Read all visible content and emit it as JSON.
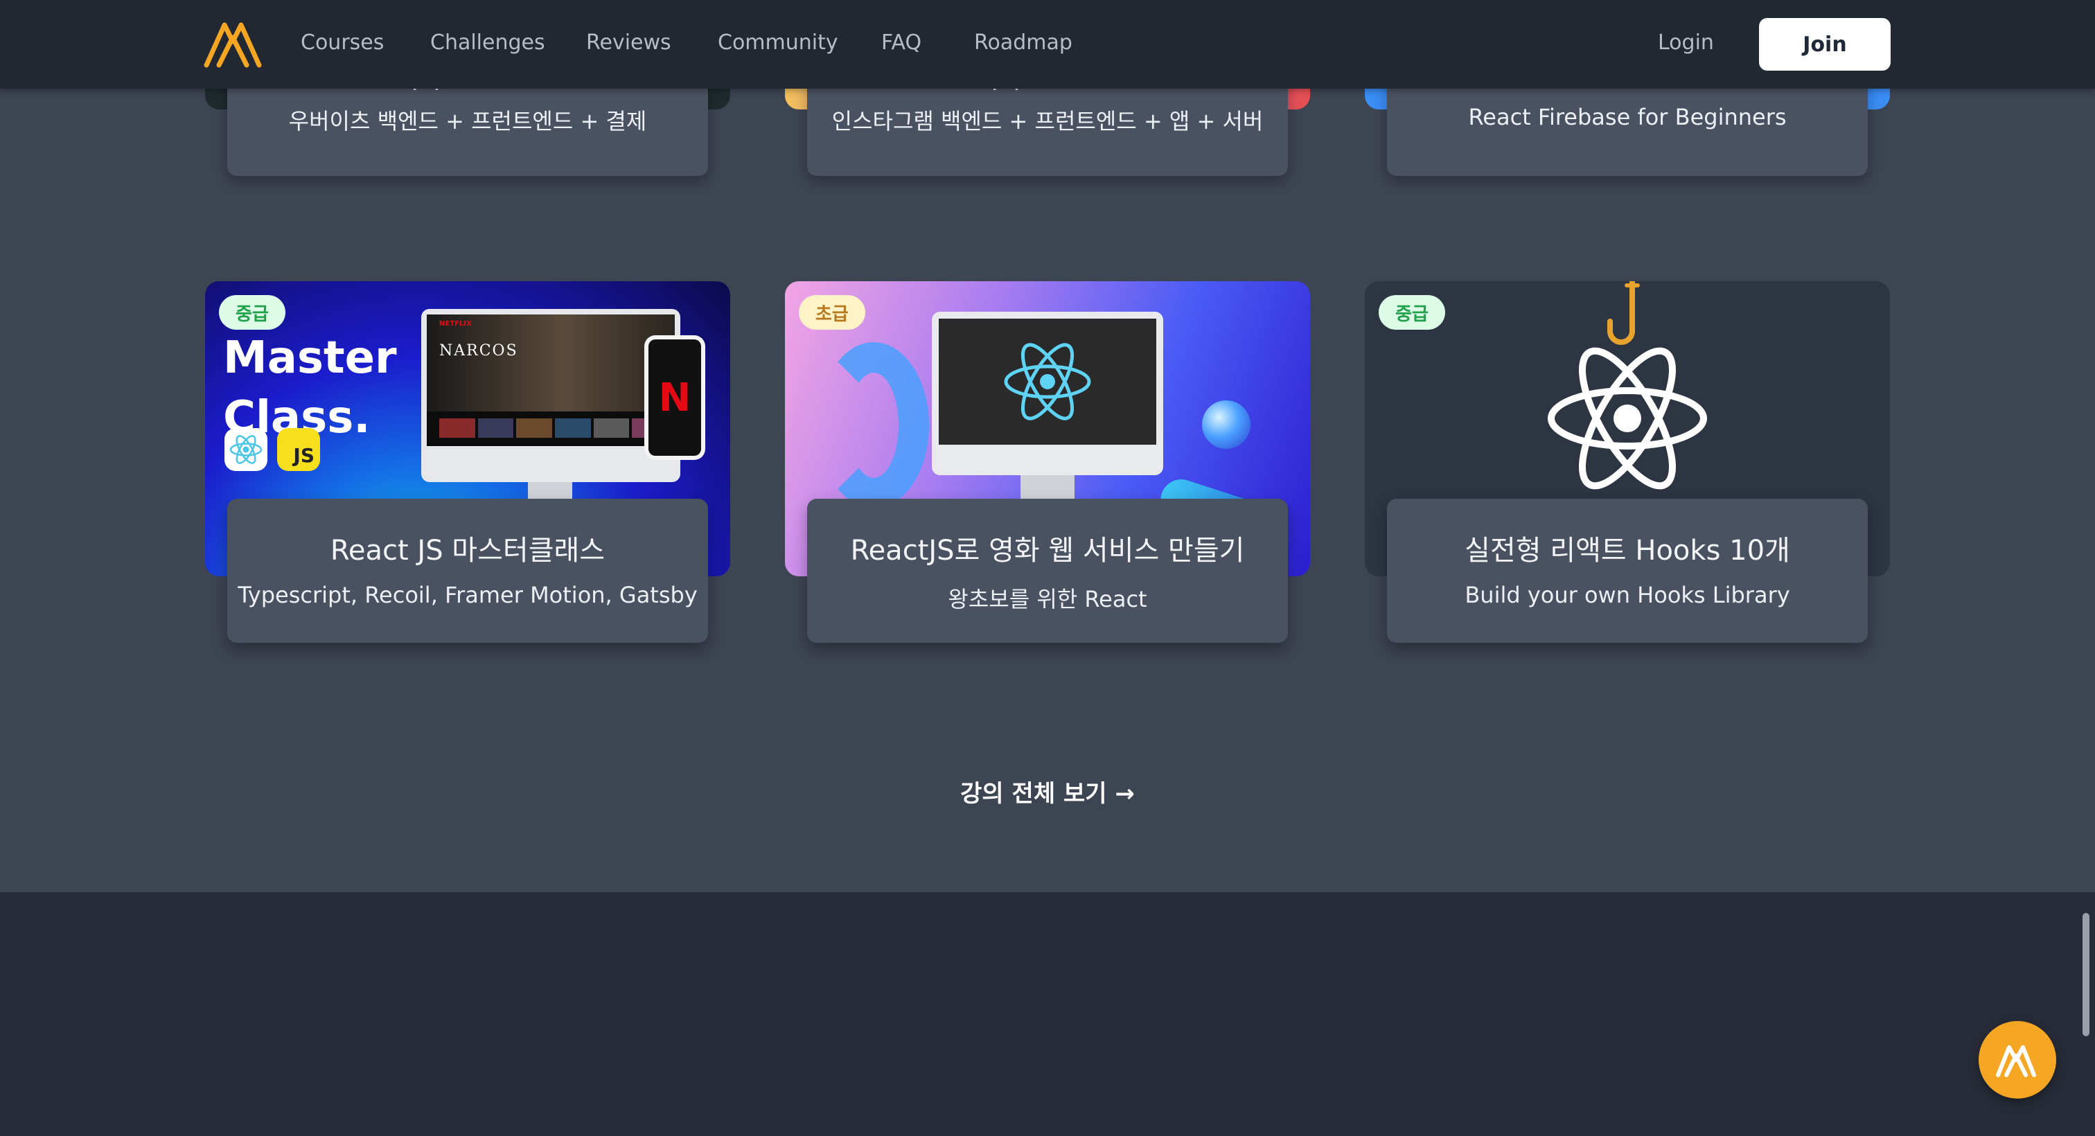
{
  "nav": {
    "links": [
      "Courses",
      "Challenges",
      "Reviews",
      "Community",
      "FAQ",
      "Roadmap"
    ],
    "login": "Login",
    "join": "Join"
  },
  "top_cards": [
    {
      "subtitle": "우버이츠 백엔드 + 프런트엔드 + 결제"
    },
    {
      "subtitle": "인스타그램 백엔드 + 프런트엔드 + 앱 + 서버"
    },
    {
      "subtitle": "React Firebase for Beginners"
    }
  ],
  "cards": [
    {
      "badge": "중급",
      "title": "React JS 마스터클래스",
      "subtitle": "Typescript, Recoil, Framer Motion, Gatsby",
      "thumb_heading": "Master Class.",
      "thumb_js": "JS",
      "thumb_show": "NARCOS",
      "thumb_brand": "NETFLIX",
      "thumb_n": "N"
    },
    {
      "badge": "초급",
      "title": "ReactJS로 영화 웹 서비스 만들기",
      "subtitle": "왕초보를 위한 React"
    },
    {
      "badge": "중급",
      "title": "실전형 리액트 Hooks 10개",
      "subtitle": "Build your own Hooks Library"
    }
  ],
  "see_all": "강의 전체 보기 →",
  "colors": {
    "accent": "#f5a623",
    "nav_bg": "#222831",
    "page_bg": "#3d4452",
    "card_bg": "#4a5160",
    "footer_bg": "#272c38"
  }
}
